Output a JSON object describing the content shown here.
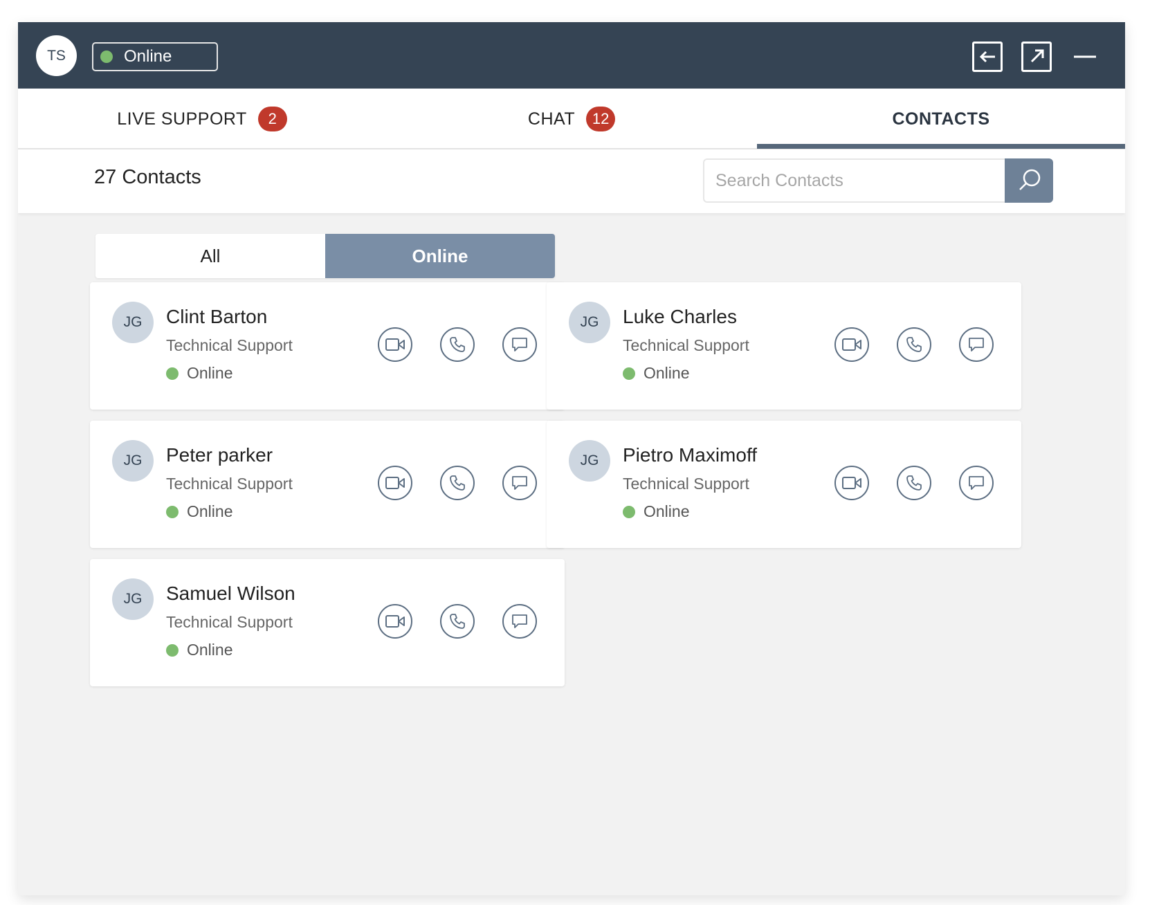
{
  "header": {
    "user_initials": "TS",
    "status_label": "Online",
    "status_color": "#7dbb6e",
    "icons": [
      "back-arrow-icon",
      "popout-icon",
      "minimize-icon"
    ]
  },
  "tabs": [
    {
      "label": "LIVE SUPPORT",
      "badge": "2",
      "active": false
    },
    {
      "label": "CHAT",
      "badge": "12",
      "active": false
    },
    {
      "label": "CONTACTS",
      "badge": null,
      "active": true
    }
  ],
  "toolbar": {
    "contacts_count": "27 Contacts",
    "search_placeholder": "Search Contacts",
    "search_value": ""
  },
  "filter": {
    "options": [
      "All",
      "Online"
    ],
    "selected": "Online"
  },
  "contacts": [
    {
      "initials": "JG",
      "name": "Clint Barton",
      "role": "Technical Support",
      "status": "Online"
    },
    {
      "initials": "JG",
      "name": "Luke Charles",
      "role": "Technical Support",
      "status": "Online"
    },
    {
      "initials": "JG",
      "name": "Peter parker",
      "role": "Technical Support",
      "status": "Online"
    },
    {
      "initials": "JG",
      "name": "Pietro Maximoff",
      "role": "Technical Support",
      "status": "Online"
    },
    {
      "initials": "JG",
      "name": "Samuel Wilson",
      "role": "Technical Support",
      "status": "Online"
    }
  ],
  "contact_actions": [
    "video-icon",
    "phone-icon",
    "message-icon"
  ],
  "colors": {
    "header_bg": "#354454",
    "badge": "#c0392b",
    "accent": "#56677a",
    "online_dot": "#7dbb6e",
    "selected_segment": "#7a8ea6"
  }
}
